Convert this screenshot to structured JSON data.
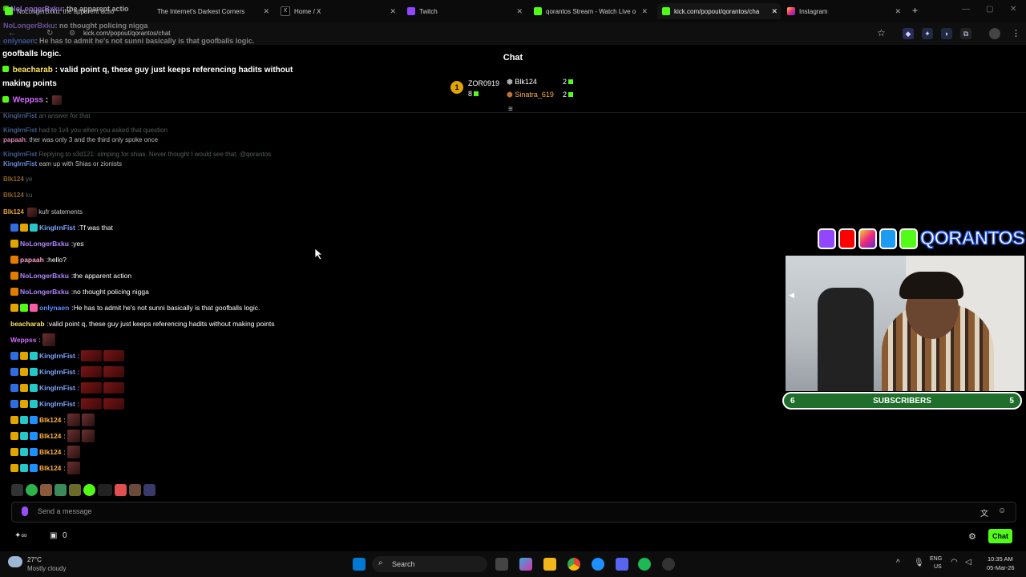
{
  "browser": {
    "tabs": [
      {
        "label": "NoLongerBxku: the apparent actio",
        "favicon": "chat-overlay-icon"
      },
      {
        "label": "The Internet's Darkest Corners",
        "favicon": "page-icon"
      },
      {
        "label": "Home / X",
        "favicon": "x-icon"
      },
      {
        "label": "Twitch",
        "favicon": "twitch-icon"
      },
      {
        "label": "qorantos Stream - Watch Live o",
        "favicon": "kick-icon"
      },
      {
        "label": "kick.com/popout/qorantos/cha",
        "favicon": "kick-icon"
      },
      {
        "label": "Instagram",
        "favicon": "instagram-icon"
      }
    ],
    "url": "kick.com/popout/qorantos/chat"
  },
  "chat": {
    "title": "Chat",
    "leaderboard": [
      {
        "rank": "1",
        "name": "ZOR0919",
        "count": "8"
      },
      {
        "name": "Blk124",
        "count": "2"
      },
      {
        "name": "Sinatra_619",
        "count": "2"
      }
    ],
    "pinned": [
      {
        "text": "goofballs logic."
      },
      {
        "user": "beacharab",
        "text": "valid point q, these guy just keeps referencing hadits without"
      },
      {
        "text": "making points"
      },
      {
        "user": "Weppss",
        "text": ":"
      }
    ],
    "overlay_lines": [
      {
        "user": "NoLongerBxku",
        "text": ": the apparent actio"
      },
      {
        "user": "NoLongerBxku",
        "text": ": no thought policing nigga"
      },
      {
        "user": "onlynaen",
        "text": ": He has to admit he's not sunni basically is that goofballs logic."
      }
    ],
    "ghost_lines": [
      {
        "user": "KingIrnFist",
        "text": "an answer for that"
      },
      {
        "user": "KingIrnFist",
        "text": "had to 1v4 you when you asked that question"
      },
      {
        "user": "papaah",
        "text": "ther was only 3 and the third only spoke once"
      },
      {
        "user": "KingIrnFist",
        "text": "Replying to s3d121: simping for shias. Never thought I would see that. @qorantos"
      },
      {
        "user": "KingIrnFist",
        "text": "eam up with Shias or zionists"
      },
      {
        "user": "Blk124",
        "text": "ye"
      },
      {
        "user": "Blk124",
        "text": "ku"
      },
      {
        "user": "Blk124",
        "text": "kufr statements"
      }
    ],
    "messages": [
      {
        "user": "KingIrnFist",
        "text": "Tf was that",
        "color": "#7aa6ff"
      },
      {
        "user": "NoLongerBxku",
        "text": "yes",
        "color": "#b084ff"
      },
      {
        "user": "papaah",
        "text": "hello?",
        "color": "#ff9bd2"
      },
      {
        "user": "NoLongerBxku",
        "text": "the apparent action",
        "color": "#b084ff"
      },
      {
        "user": "NoLongerBxku",
        "text": "no thought policing nigga",
        "color": "#b084ff"
      },
      {
        "user": "onlynaen",
        "text": "He has to admit he's not sunni basically is that goofballs logic.",
        "color": "#5b8cff"
      },
      {
        "user": "beacharab",
        "text": "valid point q, these guy just keeps referencing hadits without making points",
        "color": "#ffe35a"
      },
      {
        "user": "Weppss",
        "text": "",
        "color": "#d46bff"
      },
      {
        "user": "KingIrnFist",
        "text": "",
        "color": "#7aa6ff"
      },
      {
        "user": "KingIrnFist",
        "text": "",
        "color": "#7aa6ff"
      },
      {
        "user": "KingIrnFist",
        "text": "",
        "color": "#7aa6ff"
      },
      {
        "user": "KingIrnFist",
        "text": "",
        "color": "#7aa6ff"
      },
      {
        "user": "Blk124",
        "text": "",
        "color": "#ffb13b"
      },
      {
        "user": "Blk124",
        "text": "",
        "color": "#ffb13b"
      },
      {
        "user": "Blk124",
        "text": "",
        "color": "#ffb13b"
      },
      {
        "user": "Blk124",
        "text": "",
        "color": "#ffb13b"
      }
    ],
    "input_placeholder": "Send a message",
    "count_zero": "0",
    "chat_button": "Chat"
  },
  "stream_overlay": {
    "brand_text": "QORANTOS",
    "subscribers_label": "SUBSCRIBERS",
    "subscribers_left": "6",
    "subscribers_right": "5"
  },
  "taskbar": {
    "weather_temp": "27°C",
    "weather_desc": "Mostly cloudy",
    "search": "Search",
    "lang1": "ENG",
    "lang2": "US",
    "time": "10:35 AM",
    "date": "05-Mar-26"
  },
  "colors": {
    "kick_green": "#53fc18",
    "accent": "#53fc18"
  }
}
